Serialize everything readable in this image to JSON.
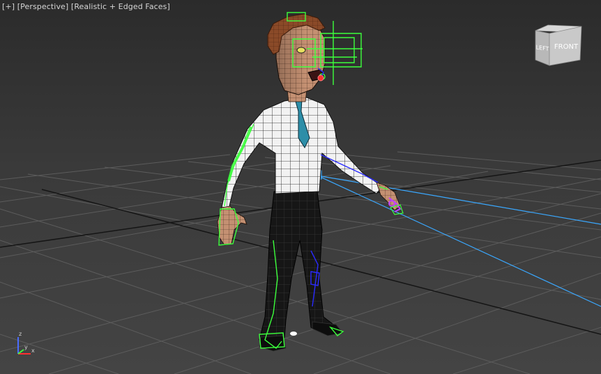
{
  "viewport": {
    "menu_label": "[+]",
    "view_label": "[Perspective]",
    "shading_label": "[Realistic + Edged Faces]"
  },
  "viewcube": {
    "left_face": "LEFT",
    "front_face": "FRONT"
  },
  "axis_triad": {
    "x": "x",
    "y": "y",
    "z": "z"
  },
  "colors": {
    "background": "#3a3a3a",
    "grid": "#5a5a5a",
    "grid_axis": "#111111",
    "bone_green": "#3cff3c",
    "bone_blue": "#2a2aff",
    "ik_line": "#3aa8ff",
    "wire": "#101010",
    "shirt": "#f2f2f2",
    "pants": "#1a1a1a",
    "tie": "#2d8ea8",
    "hair": "#8a4a2a",
    "skin": "#c99070"
  }
}
